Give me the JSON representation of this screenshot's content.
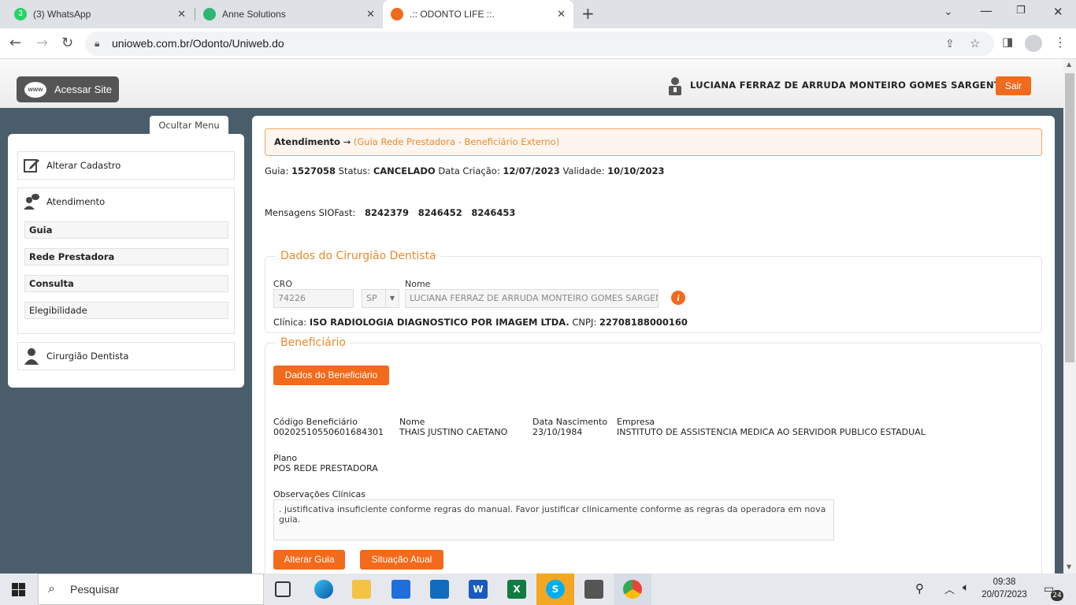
{
  "browser": {
    "tabs": [
      {
        "title": "(3) WhatsApp",
        "badge": "3",
        "fav_color": "#25d366"
      },
      {
        "title": "Anne Solutions",
        "fav_color": "#2bb673"
      },
      {
        "title": ".:: ODONTO LIFE ::.",
        "fav_color": "#f26a1b"
      }
    ],
    "url": "unioweb.com.br/Odonto/Uniweb.do"
  },
  "header": {
    "site_button": "Acessar Site",
    "www": "www",
    "user_name": "LUCIANA FERRAZ DE ARRUDA MONTEIRO GOMES SARGENTO",
    "logout": "Sair"
  },
  "sidebar": {
    "toggle": "Ocultar Menu",
    "alterar": "Alterar Cadastro",
    "atendimento": "Atendimento",
    "subitems": [
      "Guia",
      "Rede Prestadora",
      "Consulta",
      "Elegibilidade"
    ],
    "cirurgiao": "Cirurgião Dentista"
  },
  "main": {
    "breadcrumb_root": "Atendimento",
    "breadcrumb_arrow": "→",
    "breadcrumb_link": "(Guia Rede Prestadora - Beneficiário Externo)",
    "guia_label": "Guia:",
    "guia": "1527058",
    "status_label": "Status:",
    "status": "CANCELADO",
    "criacao_label": "Data Criação:",
    "criacao": "12/07/2023",
    "validade_label": "Validade:",
    "validade": "10/10/2023",
    "msgs_label": "Mensagens SIOFast:",
    "msgs": [
      "8242379",
      "8246452",
      "8246453"
    ],
    "dentista": {
      "legend": "Dados do Cirurgião Dentista",
      "cro_label": "CRO",
      "cro": "74226",
      "uf": "SP",
      "nome_label": "Nome",
      "nome": "LUCIANA FERRAZ DE ARRUDA MONTEIRO GOMES SARGENTO",
      "clinica_label": "Clínica:",
      "clinica": "ISO RADIOLOGIA DIAGNOSTICO POR IMAGEM LTDA.",
      "cnpj_label": "CNPJ:",
      "cnpj": "22708188000160"
    },
    "beneficiario": {
      "legend": "Beneficiário",
      "dados_btn": "Dados do Beneficiário",
      "codigo_label": "Código Beneficiário",
      "codigo": "00202510550601684301",
      "nome_label": "Nome",
      "nome": "THAIS JUSTINO CAETANO",
      "nasc_label": "Data Nascimento",
      "nasc": "23/10/1984",
      "empresa_label": "Empresa",
      "empresa": "INSTITUTO DE ASSISTENCIA MEDICA AO SERVIDOR PUBLICO ESTADUAL",
      "plano_label": "Plano",
      "plano": "POS REDE PRESTADORA",
      "obs_label": "Observações Clínicas",
      "obs": ". justificativa insuficiente conforme regras do manual. Favor justificar clinicamente conforme as regras da operadora em nova guia."
    },
    "alterar_btn": "Alterar Guia",
    "situacao_btn": "Situação Atual"
  },
  "taskbar": {
    "search": "Pesquisar",
    "time": "09:38",
    "date": "20/07/2023",
    "notif": "24"
  }
}
